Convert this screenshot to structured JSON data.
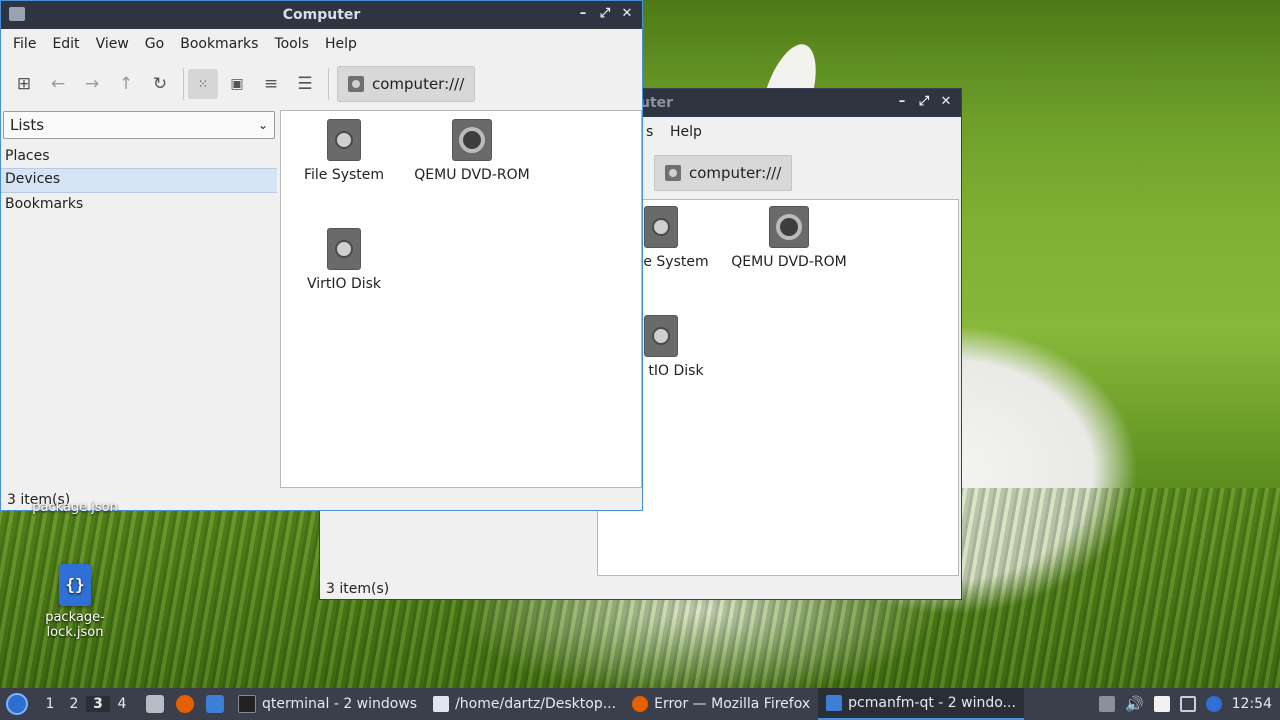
{
  "desktop": {
    "icons": [
      {
        "label": "package.json"
      },
      {
        "label": "package-lock.json",
        "glyph": "{}"
      }
    ]
  },
  "back_window": {
    "title": "Computer",
    "title_partial": "uter",
    "menu": {
      "partial_first": "s",
      "help": "Help"
    },
    "path": "computer:///",
    "items": [
      {
        "label": "File System",
        "partial": "e System"
      },
      {
        "label": "QEMU DVD-ROM",
        "partial": "QEMU DVD-ROM"
      },
      {
        "label": "VirtIO Disk",
        "partial": "tIO Disk"
      }
    ],
    "status": "3 item(s)"
  },
  "front_window": {
    "title": "Computer",
    "menu": [
      "File",
      "Edit",
      "View",
      "Go",
      "Bookmarks",
      "Tools",
      "Help"
    ],
    "toolbar": {
      "new_tab": "new-tab-icon",
      "back": "back-arrow-icon",
      "forward": "forward-arrow-icon",
      "up": "up-arrow-icon",
      "reload": "reload-icon",
      "view_icons": "icon-view-icon",
      "view_thumbnails": "thumbnail-view-icon",
      "view_compact": "compact-view-icon",
      "view_details": "detail-view-icon"
    },
    "path": "computer:///",
    "side_combo": "Lists",
    "side_items": [
      "Places",
      "Devices",
      "Bookmarks"
    ],
    "side_selected": "Devices",
    "items": [
      {
        "label": "File System"
      },
      {
        "label": "QEMU DVD-ROM"
      },
      {
        "label": "VirtIO Disk"
      }
    ],
    "status": "3 item(s)"
  },
  "taskbar": {
    "workspaces": [
      "1",
      "2",
      "3",
      "4"
    ],
    "current_workspace": "3",
    "tasks": [
      {
        "label": "qterminal - 2 windows",
        "icon": "terminal-icon"
      },
      {
        "label": "/home/dartz/Desktop...",
        "icon": "text-editor-icon"
      },
      {
        "label": "Error — Mozilla Firefox",
        "icon": "firefox-icon"
      },
      {
        "label": "pcmanfm-qt - 2 windo...",
        "icon": "folder-icon"
      }
    ],
    "clock": "12:54"
  },
  "colors": {
    "accent": "#4a90d9",
    "titlebar": "#2e3440",
    "taskbar": "#3a3f4b",
    "selection": "#d6e4f5"
  }
}
